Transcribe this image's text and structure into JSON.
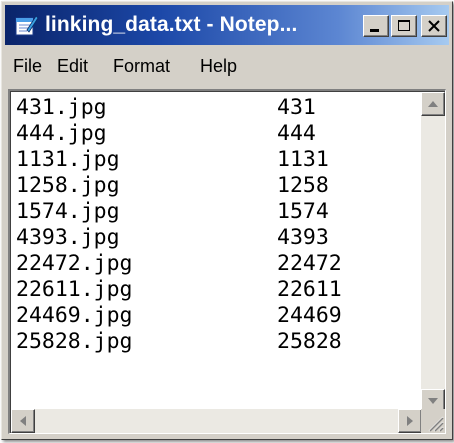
{
  "window": {
    "title": "linking_data.txt - Notep...",
    "icon": "notepad-icon",
    "controls": [
      "minimize-icon",
      "maximize-icon",
      "close-icon"
    ]
  },
  "menu": {
    "items": [
      "File",
      "Edit",
      "Format",
      "Help"
    ]
  },
  "editor": {
    "rows": [
      {
        "file": "431.jpg",
        "id": "431"
      },
      {
        "file": "444.jpg",
        "id": "444"
      },
      {
        "file": "1131.jpg",
        "id": "1131"
      },
      {
        "file": "1258.jpg",
        "id": "1258"
      },
      {
        "file": "1574.jpg",
        "id": "1574"
      },
      {
        "file": "4393.jpg",
        "id": "4393"
      },
      {
        "file": "22472.jpg",
        "id": "22472"
      },
      {
        "file": "22611.jpg",
        "id": "22611"
      },
      {
        "file": "24469.jpg",
        "id": "24469"
      },
      {
        "file": "25828.jpg",
        "id": "25828"
      }
    ]
  },
  "colors": {
    "titlebar_start": "#0a246a",
    "titlebar_end": "#a6caf0",
    "face": "#d4d0c8"
  }
}
